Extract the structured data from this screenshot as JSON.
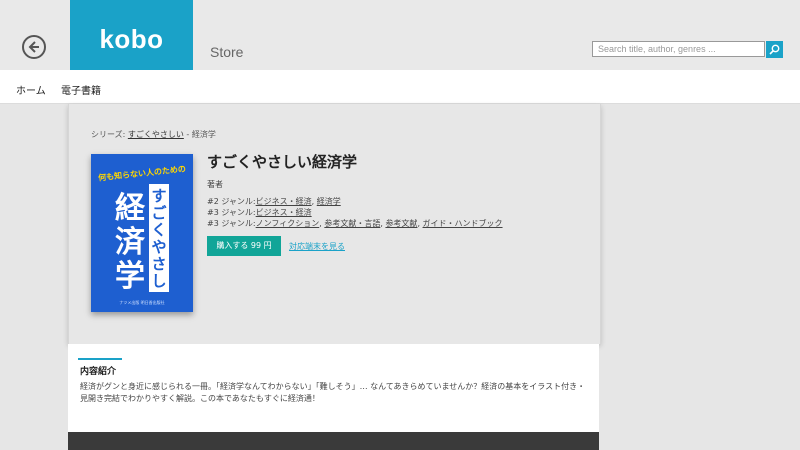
{
  "header": {
    "logo": "kobo",
    "section": "Store",
    "search_placeholder": "Search title, author, genres ...",
    "accent_color": "#1aa2c8"
  },
  "nav": {
    "items": [
      {
        "label": "ホーム"
      },
      {
        "label": "電子書籍"
      }
    ]
  },
  "breadcrumb": {
    "prefix": "シリーズ:",
    "series": "すごくやさしい",
    "separator": " - ",
    "current": "経済学"
  },
  "book": {
    "title": "すごくやさしい経済学",
    "author_label": "著者",
    "genres": [
      {
        "prefix": "#2 ジャンル:",
        "links": [
          "ビジネス・経済",
          "経済学"
        ]
      },
      {
        "prefix": "#3 ジャンル:",
        "links": [
          "ビジネス・経済"
        ]
      },
      {
        "prefix": "#3 ジャンル:",
        "links": [
          "ノンフィクション",
          "参考文献・言語",
          "参考文献",
          "ガイド・ハンドブック"
        ]
      }
    ],
    "buy_label": "購入する 99 円",
    "device_link": "対応端末を見る",
    "buy_color": "#11a598"
  },
  "cover": {
    "tagline": "何も知らない人のための",
    "title_big": "経済学",
    "subtitle": "すごくやさしい",
    "publisher": "ナツメ出版 明日香出版社",
    "color": "#1e5fd0"
  },
  "description": {
    "heading": "内容紹介",
    "body": "経済がグンと身近に感じられる一冊。「経済学なんてわからない」「難しそう」… なんてあきらめていませんか？経済の基本をイラスト付き・見開き完結でわかりやすく解説。この本であなたもすぐに経済通！"
  }
}
